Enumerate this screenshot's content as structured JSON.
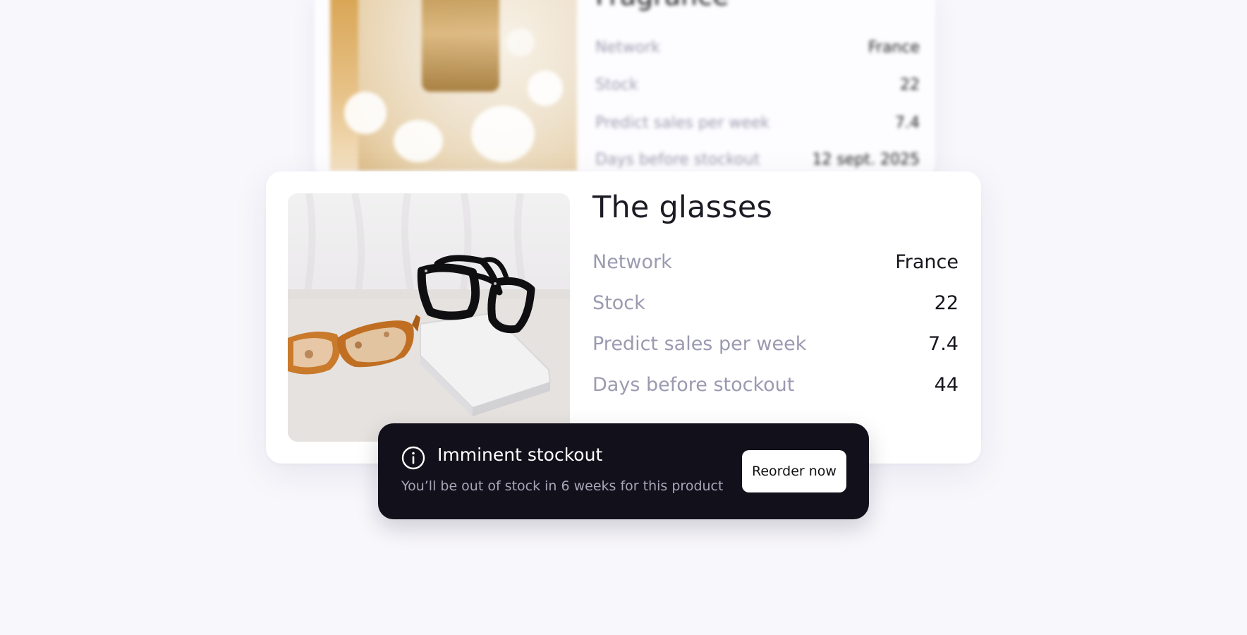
{
  "background_card": {
    "title": "Fragrance",
    "rows": [
      {
        "label": "Network",
        "value": "France"
      },
      {
        "label": "Stock",
        "value": "22"
      },
      {
        "label": "Predict sales per week",
        "value": "7.4"
      },
      {
        "label": "Days before stockout",
        "value": "12 sept. 2025"
      }
    ]
  },
  "product": {
    "title": "The glasses",
    "rows": [
      {
        "label": "Network",
        "value": "France"
      },
      {
        "label": "Stock",
        "value": "22"
      },
      {
        "label": "Predict sales per week",
        "value": "7.4"
      },
      {
        "label": "Days before stockout",
        "value": "44"
      }
    ]
  },
  "toast": {
    "icon": "info-icon",
    "title": "Imminent stockout",
    "message": "You’ll be out of stock in 6 weeks for this product",
    "button_label": "Reorder now"
  },
  "colors": {
    "page_background": "#f8f7fc",
    "card_background": "#ffffff",
    "label_text": "#9b9ab1",
    "value_text": "#16161e",
    "toast_background": "#12111b",
    "toast_message": "#a7a6b8"
  }
}
